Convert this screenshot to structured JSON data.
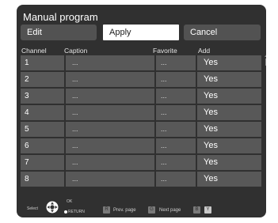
{
  "window": {
    "title": "Manual program"
  },
  "buttons": {
    "edit": "Edit",
    "apply": "Apply",
    "cancel": "Cancel"
  },
  "columns": {
    "channel": "Channel",
    "caption": "Caption",
    "favorite": "Favorite",
    "add": "Add"
  },
  "rows": [
    {
      "channel": "1",
      "caption": "...",
      "favorite": "...",
      "add": "Yes"
    },
    {
      "channel": "2",
      "caption": "...",
      "favorite": "...",
      "add": "Yes"
    },
    {
      "channel": "3",
      "caption": "...",
      "favorite": "...",
      "add": "Yes"
    },
    {
      "channel": "4",
      "caption": "...",
      "favorite": "...",
      "add": "Yes"
    },
    {
      "channel": "5",
      "caption": "...",
      "favorite": "...",
      "add": "Yes"
    },
    {
      "channel": "6",
      "caption": "...",
      "favorite": "...",
      "add": "Yes"
    },
    {
      "channel": "7",
      "caption": "...",
      "favorite": "...",
      "add": "Yes"
    },
    {
      "channel": "8",
      "caption": "...",
      "favorite": "...",
      "add": "Yes"
    }
  ],
  "footer": {
    "select": "Select",
    "ok": "OK",
    "return": "RETURN",
    "key_r": "R",
    "prev_page": "Prev. page",
    "key_g": "G",
    "next_page": "Next page",
    "key_b": "B",
    "key_y": "Y"
  },
  "colors": {
    "background": "#303030",
    "cell": "#585858",
    "highlight": "#ffffff",
    "text": "#ffffff"
  }
}
